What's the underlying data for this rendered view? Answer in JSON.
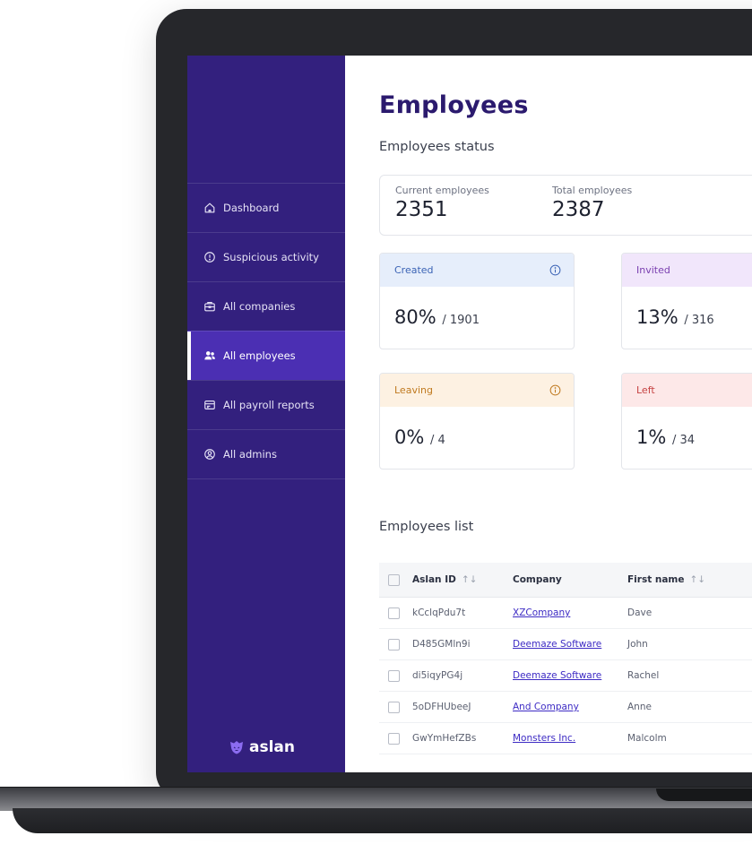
{
  "sidebar": {
    "items": [
      {
        "label": "Dashboard",
        "icon": "home-icon",
        "active": false
      },
      {
        "label": "Suspicious activity",
        "icon": "alert-circle-icon",
        "active": false
      },
      {
        "label": "All companies",
        "icon": "briefcase-icon",
        "active": false
      },
      {
        "label": "All employees",
        "icon": "users-icon",
        "active": true
      },
      {
        "label": "All payroll reports",
        "icon": "payroll-icon",
        "active": false
      },
      {
        "label": "All admins",
        "icon": "admin-icon",
        "active": false
      }
    ],
    "logo_text": "aslan"
  },
  "main": {
    "title": "Employees",
    "status_heading": "Employees status",
    "totals": {
      "current_label": "Current employees",
      "current_value": "2351",
      "total_label": "Total employees",
      "total_value": "2387"
    },
    "cards": [
      {
        "label": "Created",
        "percent": "80%",
        "fraction": "/ 1901",
        "has_info": true,
        "head_bg": "#e6eefb",
        "label_color": "#3b63b5"
      },
      {
        "label": "Invited",
        "percent": "13%",
        "fraction": "/ 316",
        "has_info": false,
        "head_bg": "#f1e6fb",
        "label_color": "#7a3fb0"
      },
      {
        "label": "Leaving",
        "percent": "0%",
        "fraction": "/ 4",
        "has_info": true,
        "head_bg": "#fdf1e2",
        "label_color": "#c07a20"
      },
      {
        "label": "Left",
        "percent": "1%",
        "fraction": "/ 34",
        "has_info": false,
        "head_bg": "#fde8e8",
        "label_color": "#c64343"
      }
    ],
    "list_heading": "Employees list",
    "table": {
      "headers": {
        "aslan_id": "Aslan ID",
        "company": "Company",
        "first_name": "First name",
        "sort_glyph": "↑↓"
      },
      "rows": [
        {
          "aslan_id": "kCclqPdu7t",
          "company": "XZCompany",
          "first_name": "Dave"
        },
        {
          "aslan_id": "D485GMln9i",
          "company": "Deemaze Software",
          "first_name": "John"
        },
        {
          "aslan_id": "di5iqyPG4j",
          "company": "Deemaze Software",
          "first_name": "Rachel"
        },
        {
          "aslan_id": "5oDFHUbeeJ",
          "company": "And Company",
          "first_name": "Anne"
        },
        {
          "aslan_id": "GwYmHefZBs",
          "company": "Monsters Inc.",
          "first_name": "Malcolm"
        }
      ]
    }
  },
  "colors": {
    "sidebar_bg": "#33207e",
    "sidebar_active": "#4b2fb3",
    "title": "#2b1a6e",
    "link": "#3d2bc4"
  }
}
